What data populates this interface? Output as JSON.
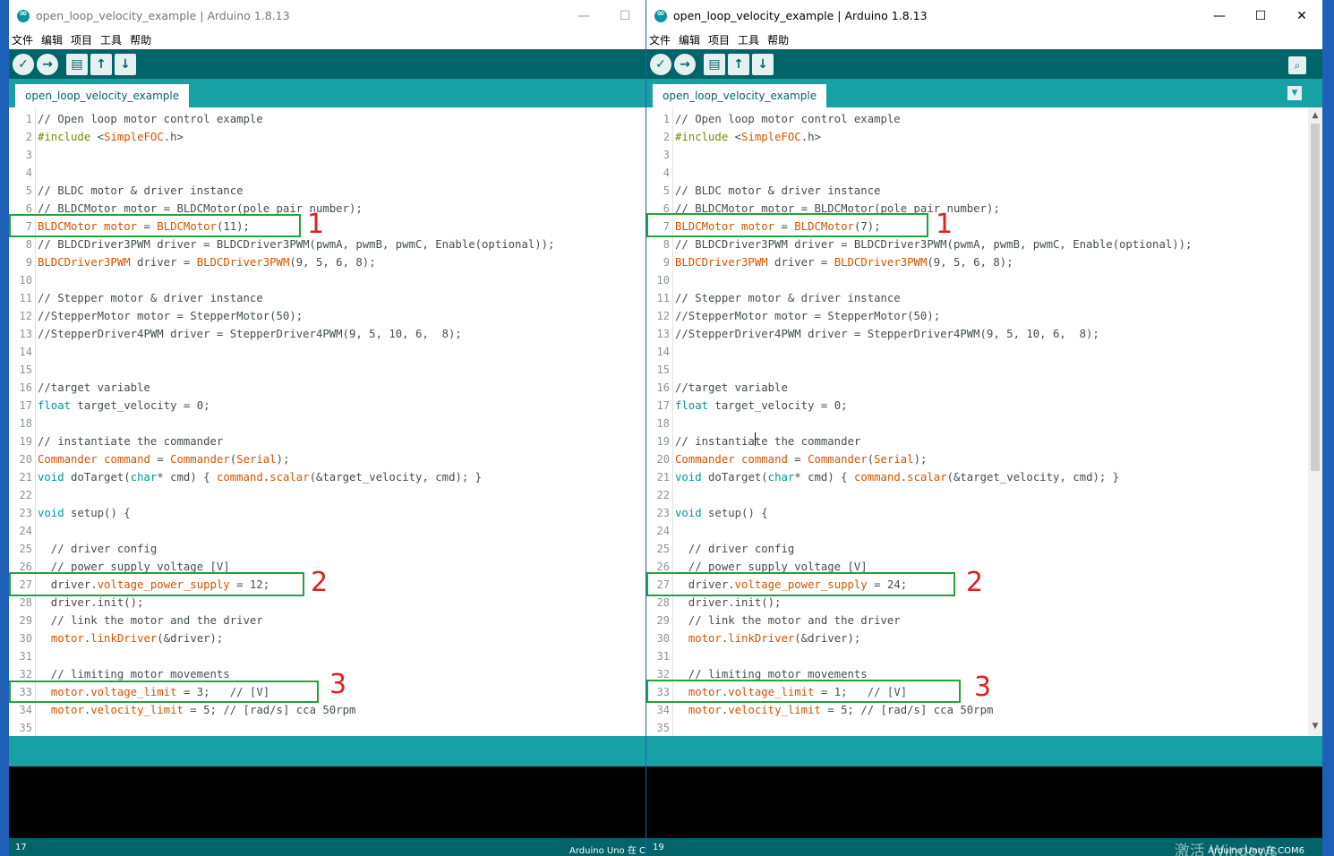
{
  "left": {
    "title": "open_loop_velocity_example | Arduino 1.8.13",
    "tab": "open_loop_velocity_example",
    "status_line": "17",
    "board": "Arduino Uno 在 C",
    "marks": [
      "1",
      "2",
      "3"
    ],
    "lines": [
      {
        "n": "1",
        "html": "<span>// Open loop motor control example</span>"
      },
      {
        "n": "2",
        "html": "<span class='k3'>#include</span> &lt;<span class='k1'>SimpleFOC</span>.h&gt;"
      },
      {
        "n": "3",
        "html": ""
      },
      {
        "n": "4",
        "html": ""
      },
      {
        "n": "5",
        "html": "// BLDC motor &amp; driver instance"
      },
      {
        "n": "6",
        "html": "// BLDCMotor motor = BLDCMotor(pole pair number);"
      },
      {
        "n": "7",
        "html": "<span class='k1'>BLDCMotor</span> <span class='k1'>motor</span> = <span class='k1'>BLDCMotor</span>(11);"
      },
      {
        "n": "8",
        "html": "// BLDCDriver3PWM driver = BLDCDriver3PWM(pwmA, pwmB, pwmC, Enable(optional));"
      },
      {
        "n": "9",
        "html": "<span class='k1'>BLDCDriver3PWM</span> driver = <span class='k1'>BLDCDriver3PWM</span>(9, 5, 6, 8);"
      },
      {
        "n": "10",
        "html": ""
      },
      {
        "n": "11",
        "html": "// Stepper motor &amp; driver instance"
      },
      {
        "n": "12",
        "html": "//StepperMotor motor = StepperMotor(50);"
      },
      {
        "n": "13",
        "html": "//StepperDriver4PWM driver = StepperDriver4PWM(9, 5, 10, 6,  8);"
      },
      {
        "n": "14",
        "html": ""
      },
      {
        "n": "15",
        "html": ""
      },
      {
        "n": "16",
        "html": "//target variable"
      },
      {
        "n": "17",
        "html": "<span class='k2'>float</span> target_velocity = 0;"
      },
      {
        "n": "18",
        "html": ""
      },
      {
        "n": "19",
        "html": "// instantiate the commander"
      },
      {
        "n": "20",
        "html": "<span class='k1'>Commander</span> <span class='k1'>command</span> = <span class='k1'>Commander</span>(<span class='k1'>Serial</span>);"
      },
      {
        "n": "21",
        "html": "<span class='k2'>void</span> doTarget(<span class='k2'>char</span>* cmd) { <span class='k1'>command</span>.<span class='k1'>scalar</span>(&amp;target_velocity, cmd); }"
      },
      {
        "n": "22",
        "html": ""
      },
      {
        "n": "23",
        "html": "<span class='k2'>void</span> setup() {"
      },
      {
        "n": "24",
        "html": ""
      },
      {
        "n": "25",
        "html": "  // driver config"
      },
      {
        "n": "26",
        "html": "  // power supply voltage [V]"
      },
      {
        "n": "27",
        "html": "  driver.<span class='k1'>voltage_power_supply</span> = 12;"
      },
      {
        "n": "28",
        "html": "  driver.init();"
      },
      {
        "n": "29",
        "html": "  // link the motor and the driver"
      },
      {
        "n": "30",
        "html": "  <span class='k1'>motor</span>.<span class='k1'>linkDriver</span>(&amp;driver);"
      },
      {
        "n": "31",
        "html": ""
      },
      {
        "n": "32",
        "html": "  // limiting motor movements"
      },
      {
        "n": "33",
        "html": "  <span class='k1'>motor</span>.<span class='k1'>voltage_limit</span> = 3;   // [V]"
      },
      {
        "n": "34",
        "html": "  <span class='k1'>motor</span>.<span class='k1'>velocity_limit</span> = 5; // [rad/s] cca 50rpm"
      },
      {
        "n": "35",
        "html": ""
      }
    ]
  },
  "right": {
    "title": "open_loop_velocity_example | Arduino 1.8.13",
    "tab": "open_loop_velocity_example",
    "status_line": "19",
    "board": "Arduino Uno 在 COM6",
    "watermark": "激活 Windows",
    "marks": [
      "1",
      "2",
      "3"
    ],
    "lines": [
      {
        "n": "1",
        "html": "// Open loop motor control example"
      },
      {
        "n": "2",
        "html": "<span class='k3'>#include</span> &lt;<span class='k1'>SimpleFOC</span>.h&gt;"
      },
      {
        "n": "3",
        "html": ""
      },
      {
        "n": "4",
        "html": ""
      },
      {
        "n": "5",
        "html": "// BLDC motor &amp; driver instance"
      },
      {
        "n": "6",
        "html": "// BLDCMotor motor = BLDCMotor(pole pair number);"
      },
      {
        "n": "7",
        "html": "<span class='k1'>BLDCMotor</span> <span class='k1'>motor</span> = <span class='k1'>BLDCMotor</span>(7);"
      },
      {
        "n": "8",
        "html": "// BLDCDriver3PWM driver = BLDCDriver3PWM(pwmA, pwmB, pwmC, Enable(optional));"
      },
      {
        "n": "9",
        "html": "<span class='k1'>BLDCDriver3PWM</span> driver = <span class='k1'>BLDCDriver3PWM</span>(9, 5, 6, 8);"
      },
      {
        "n": "10",
        "html": ""
      },
      {
        "n": "11",
        "html": "// Stepper motor &amp; driver instance"
      },
      {
        "n": "12",
        "html": "//StepperMotor motor = StepperMotor(50);"
      },
      {
        "n": "13",
        "html": "//StepperDriver4PWM driver = StepperDriver4PWM(9, 5, 10, 6,  8);"
      },
      {
        "n": "14",
        "html": ""
      },
      {
        "n": "15",
        "html": ""
      },
      {
        "n": "16",
        "html": "//target variable"
      },
      {
        "n": "17",
        "html": "<span class='k2'>float</span> target_velocity = 0;"
      },
      {
        "n": "18",
        "html": ""
      },
      {
        "n": "19",
        "html": "// instantiate the commander"
      },
      {
        "n": "20",
        "html": "<span class='k1'>Commander</span> <span class='k1'>command</span> = <span class='k1'>Commander</span>(<span class='k1'>Serial</span>);"
      },
      {
        "n": "21",
        "html": "<span class='k2'>void</span> doTarget(<span class='k2'>char</span>* cmd) { <span class='k1'>command</span>.<span class='k1'>scalar</span>(&amp;target_velocity, cmd); }"
      },
      {
        "n": "22",
        "html": ""
      },
      {
        "n": "23",
        "html": "<span class='k2'>void</span> setup() {"
      },
      {
        "n": "24",
        "html": ""
      },
      {
        "n": "25",
        "html": "  // driver config"
      },
      {
        "n": "26",
        "html": "  // power supply voltage [V]"
      },
      {
        "n": "27",
        "html": "  driver.<span class='k1'>voltage_power_supply</span> = 24;"
      },
      {
        "n": "28",
        "html": "  driver.init();"
      },
      {
        "n": "29",
        "html": "  // link the motor and the driver"
      },
      {
        "n": "30",
        "html": "  <span class='k1'>motor</span>.<span class='k1'>linkDriver</span>(&amp;driver);"
      },
      {
        "n": "31",
        "html": ""
      },
      {
        "n": "32",
        "html": "  // limiting motor movements"
      },
      {
        "n": "33",
        "html": "  <span class='k1'>motor</span>.<span class='k1'>voltage_limit</span> = 1;   // [V]"
      },
      {
        "n": "34",
        "html": "  <span class='k1'>motor</span>.<span class='k1'>velocity_limit</span> = 5; // [rad/s] cca 50rpm"
      },
      {
        "n": "35",
        "html": ""
      }
    ]
  },
  "menu": [
    "文件",
    "编辑",
    "项目",
    "工具",
    "帮助"
  ],
  "winctrl": {
    "min": "—",
    "max": "☐",
    "close": "✕"
  },
  "icons": {
    "verify": "verify-icon",
    "upload": "upload-icon",
    "new": "new-icon",
    "open": "open-icon",
    "save": "save-icon",
    "serial": "serial-monitor-icon"
  }
}
